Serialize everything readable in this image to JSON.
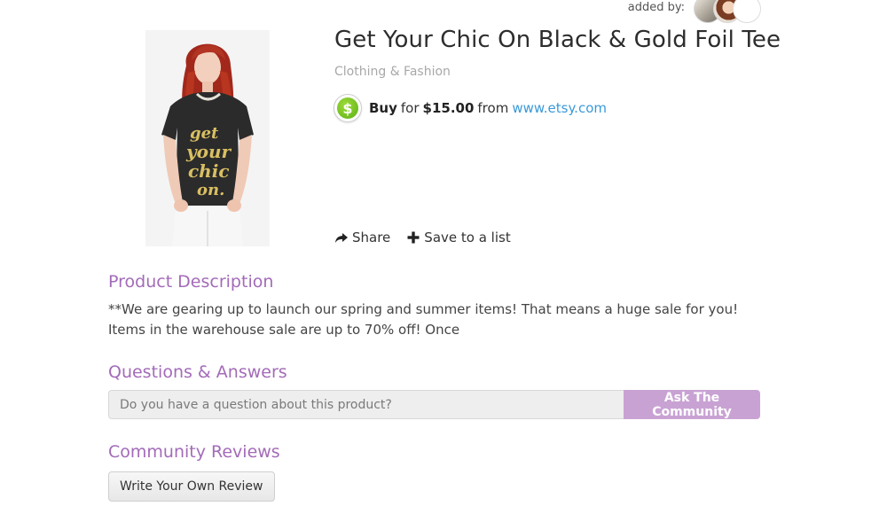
{
  "added_by": {
    "label": "added by:"
  },
  "product": {
    "title": "Get Your Chic On Black & Gold Foil Tee",
    "category": "Clothing & Fashion",
    "image_text": "get your chic on",
    "buy": {
      "icon": "dollar-icon",
      "icon_color": "#7cc52b",
      "buy_label": "Buy",
      "for_label": "for",
      "price": "$15.00",
      "from_label": "from",
      "store_link": "www.etsy.com"
    },
    "actions": {
      "share_label": "Share",
      "save_label": "Save to a list"
    }
  },
  "description": {
    "heading": "Product Description",
    "text": "**We are gearing up to launch our spring and summer items! That means a huge sale for you! Items in the warehouse sale are up to 70% off! Once"
  },
  "qa": {
    "heading": "Questions & Answers",
    "placeholder": "Do you have a question about this product?",
    "button_label": "Ask The Community"
  },
  "reviews": {
    "heading": "Community Reviews",
    "button_label": "Write Your Own Review"
  },
  "colors": {
    "accent_purple": "#a36bb8",
    "button_purple": "#c9a2d4",
    "link_blue": "#3a9ad9"
  }
}
